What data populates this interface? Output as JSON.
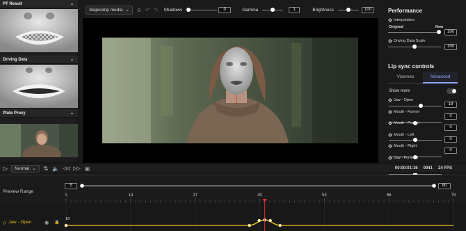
{
  "left_panel": {
    "pt_result": "PT Result",
    "driving_data": "Driving Data",
    "plate_proxy": "Plate Proxy"
  },
  "toolbar": {
    "media_select": "Slapcomp media",
    "shadows_label": "Shadows",
    "shadows_value": "0",
    "shadows_level": 0.0,
    "gamma_label": "Gamma",
    "gamma_value": "1",
    "gamma_level": 0.5,
    "brightness_label": "Brightness",
    "brightness_value": "100",
    "brightness_level": 0.5
  },
  "right_panel": {
    "performance_title": "Performance",
    "interpolation_label": "Interpolation",
    "original_label": "Original",
    "new_label": "New",
    "interpolation_value": "100",
    "interpolation_level": 1.0,
    "driving_scale_label": "Driving Data Scale",
    "driving_scale_value": "100",
    "driving_scale_level": 0.5,
    "lip_sync_title": "Lip sync controls",
    "tabs": [
      {
        "label": "Visemes",
        "active": false
      },
      {
        "label": "Advanced",
        "active": true
      }
    ],
    "show_more_label": "Show more",
    "show_more_on": false,
    "controls": [
      {
        "label": "Jaw - Open",
        "value": "19",
        "level": 0.6
      },
      {
        "label": "Mouth - Funnel",
        "value": "0",
        "level": 0.5
      },
      {
        "label": "Mouth - Pucker",
        "value": "0",
        "level": 0.5
      },
      {
        "label": "Mouth - Left",
        "value": "0",
        "level": 0.5
      },
      {
        "label": "Mouth - Right",
        "value": "0",
        "level": 0.5
      },
      {
        "label": "Jaw - Forward",
        "value": "",
        "level": 0.5
      }
    ]
  },
  "player": {
    "speed": "Normal",
    "timecode": "00:00:01:16",
    "frame": "0041",
    "fps": "24 FPS"
  },
  "timeline": {
    "preview_range_label": "Preview Range",
    "range_start": "5",
    "range_end": "80",
    "ruler_ticks": [
      "1",
      "14",
      "27",
      "40",
      "53",
      "66",
      "79"
    ],
    "current_frame": 41,
    "track_label": "Jaw - Open",
    "track_start_value": "19",
    "accent_color": "#e6c320",
    "playhead_color": "#e03030"
  }
}
